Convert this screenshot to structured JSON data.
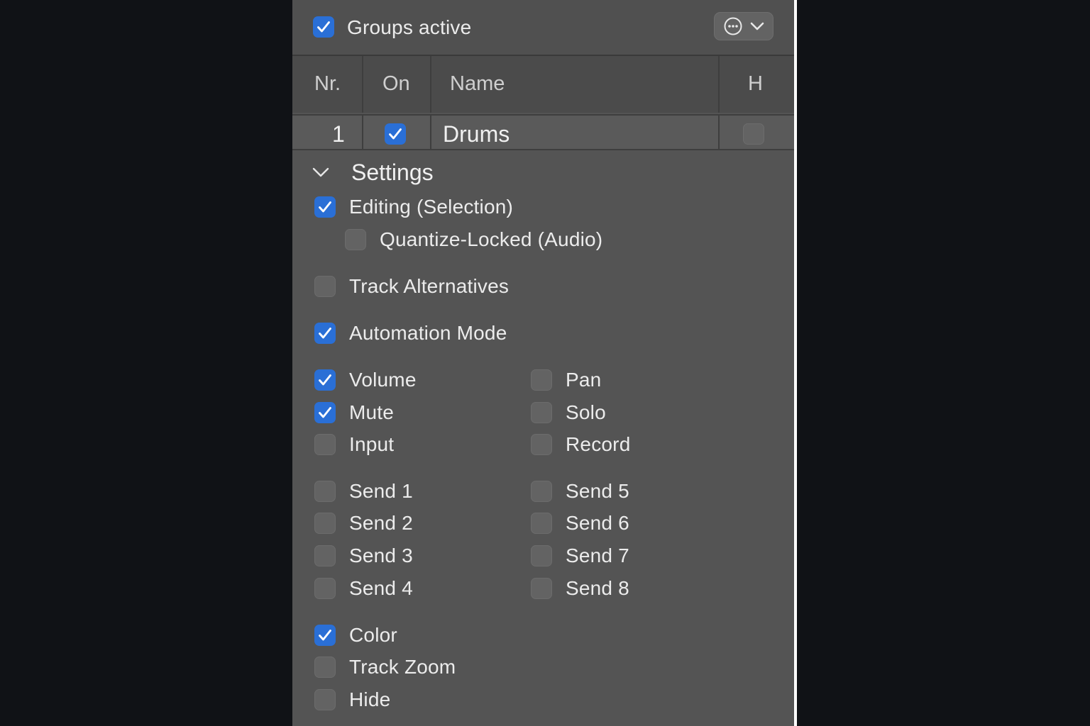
{
  "header": {
    "groups_active_label": "Groups active",
    "groups_active_checked": true
  },
  "table": {
    "columns": [
      "Nr.",
      "On",
      "Name",
      "H"
    ],
    "rows": [
      {
        "nr": "1",
        "on": true,
        "name": "Drums",
        "h": false
      }
    ]
  },
  "settings": {
    "title": "Settings",
    "options": [
      {
        "label": "Editing (Selection)",
        "checked": true
      },
      {
        "label": "Quantize-Locked (Audio)",
        "checked": false
      },
      {
        "label": "Track Alternatives",
        "checked": false
      },
      {
        "label": "Automation Mode",
        "checked": true
      },
      {
        "label": "Volume",
        "checked": true
      },
      {
        "label": "Pan",
        "checked": false
      },
      {
        "label": "Mute",
        "checked": true
      },
      {
        "label": "Solo",
        "checked": false
      },
      {
        "label": "Input",
        "checked": false
      },
      {
        "label": "Record",
        "checked": false
      },
      {
        "label": "Send 1",
        "checked": false
      },
      {
        "label": "Send 5",
        "checked": false
      },
      {
        "label": "Send 2",
        "checked": false
      },
      {
        "label": "Send 6",
        "checked": false
      },
      {
        "label": "Send 3",
        "checked": false
      },
      {
        "label": "Send 7",
        "checked": false
      },
      {
        "label": "Send 4",
        "checked": false
      },
      {
        "label": "Send 8",
        "checked": false
      },
      {
        "label": "Color",
        "checked": true
      },
      {
        "label": "Track Zoom",
        "checked": false
      },
      {
        "label": "Hide",
        "checked": false
      }
    ]
  },
  "icons": {
    "menu": "ellipsis-circle-icon",
    "menu_chevron": "chevron-down-icon",
    "disclosure": "chevron-down-icon",
    "check": "checkmark-icon"
  },
  "colors": {
    "accent": "#2a6fd6",
    "panel": "#545454",
    "background": "#101216"
  }
}
